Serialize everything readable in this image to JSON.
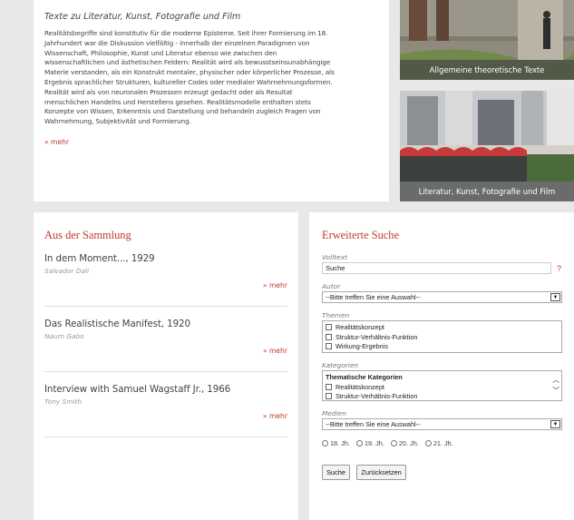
{
  "intro": {
    "heading": "Texte zu Literatur, Kunst, Fotografie und Film",
    "lines": [
      "Realitätsbegriffe sind konstitutiv für die moderne Episteme. Seit ihrer Formierung im 18.",
      "Jahrhundert war die Diskussion vielfältig - innerhalb der einzelnen Paradigmen von",
      "Wissenschaft, Philosophie, Kunst und Literatur ebenso wie zwischen den",
      "wissenschaftlichen und ästhetischen Feldern: Realität wird als bewusstseinsunabhängige",
      "Materie verstanden, als ein Konstrukt mentaler, physischer oder körperlicher Prozesse, als",
      "Ergebnis sprachlicher Strukturen, kultureller Codes oder medialer Wahrnehmungsformen.",
      "Realität wird als von neuronalen Prozessen erzeugt gedacht oder als Resultat",
      "menschlichen Handelns und Herstellens gesehen. Realitätsmodelle enthalten stets",
      "Konzepte von Wissen, Erkenntnis und Darstellung und behandeln zugleich Fragen von",
      "Wahrnehmung, Subjektivität und Formierung."
    ],
    "mehr": "» mehr"
  },
  "thumbs": [
    {
      "caption": "Allgemeine theoretische Texte"
    },
    {
      "caption": "Literatur, Kunst, Fotografie und Film"
    }
  ],
  "sammlung": {
    "title": "Aus der Sammlung",
    "items": [
      {
        "title": "In dem Moment..., 1929",
        "author": "Salvador Dalí",
        "mehr": "» mehr"
      },
      {
        "title": "Das Realistische Manifest, 1920",
        "author": "Naum Gabo",
        "mehr": "» mehr"
      },
      {
        "title": "Interview with Samuel Wagstaff Jr., 1966",
        "author": "Tony Smith",
        "mehr": "» mehr"
      }
    ]
  },
  "suche": {
    "title": "Erweiterte Suche",
    "volltext": {
      "label": "Volltext",
      "value": "Suche",
      "help": "?"
    },
    "autor": {
      "label": "Autor",
      "selected": "--Bitte treffen Sie eine Auswahl--"
    },
    "themen": {
      "label": "Themen",
      "options": [
        "Realitätskonzept",
        "Struktur-Verhältnis-Funktion",
        "Wirkung-Ergebnis"
      ]
    },
    "kategorien": {
      "label": "Kategorien",
      "group": "Thematische Kategorien",
      "options": [
        "Realitätskonzept",
        "Struktur-Verhältnis-Funktion"
      ]
    },
    "medien": {
      "label": "Medien",
      "selected": "--Bitte treffen Sie eine Auswahl--"
    },
    "zeit": [
      "18. Jh.",
      "19. Jh.",
      "20. Jh.",
      "21. Jh."
    ],
    "submit_label": "Suche",
    "reset_label": "Zurücksetzen"
  }
}
